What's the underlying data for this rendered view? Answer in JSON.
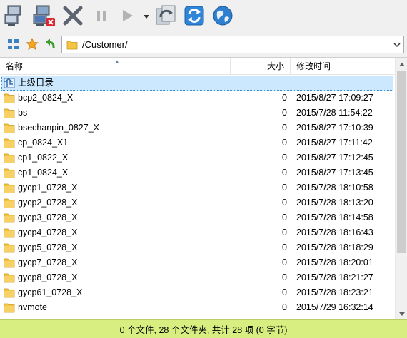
{
  "toolbar": {
    "buttons": [
      {
        "name": "connect",
        "icon": "network-computers-icon"
      },
      {
        "name": "disconnect",
        "icon": "disconnect-computers-icon"
      },
      {
        "name": "stop",
        "icon": "close-x-icon"
      },
      {
        "name": "pause",
        "icon": "pause-icon"
      },
      {
        "name": "play",
        "icon": "play-icon"
      },
      {
        "name": "sync",
        "icon": "sync-folder-icon"
      },
      {
        "name": "refresh",
        "icon": "refresh-icon"
      },
      {
        "name": "web",
        "icon": "globe-icon"
      }
    ]
  },
  "address_bar": {
    "path": "/Customer/"
  },
  "columns": {
    "name": "名称",
    "size": "大小",
    "modified": "修改时间"
  },
  "parent_row": {
    "label": "上级目录"
  },
  "files": [
    {
      "name": "bcp2_0824_X",
      "size": "0",
      "modified": "2015/8/27 17:09:27"
    },
    {
      "name": "bs",
      "size": "0",
      "modified": "2015/7/28 11:54:22"
    },
    {
      "name": "bsechanpin_0827_X",
      "size": "0",
      "modified": "2015/8/27 17:10:39"
    },
    {
      "name": "cp_0824_X1",
      "size": "0",
      "modified": "2015/8/27 17:11:42"
    },
    {
      "name": "cp1_0822_X",
      "size": "0",
      "modified": "2015/8/27 17:12:45"
    },
    {
      "name": "cp1_0824_X",
      "size": "0",
      "modified": "2015/8/27 17:13:45"
    },
    {
      "name": "gycp1_0728_X",
      "size": "0",
      "modified": "2015/7/28 18:10:58"
    },
    {
      "name": "gycp2_0728_X",
      "size": "0",
      "modified": "2015/7/28 18:13:20"
    },
    {
      "name": "gycp3_0728_X",
      "size": "0",
      "modified": "2015/7/28 18:14:58"
    },
    {
      "name": "gycp4_0728_X",
      "size": "0",
      "modified": "2015/7/28 18:16:43"
    },
    {
      "name": "gycp5_0728_X",
      "size": "0",
      "modified": "2015/7/28 18:18:29"
    },
    {
      "name": "gycp7_0728_X",
      "size": "0",
      "modified": "2015/7/28 18:20:01"
    },
    {
      "name": "gycp8_0728_X",
      "size": "0",
      "modified": "2015/7/28 18:21:27"
    },
    {
      "name": "gycp61_0728_X",
      "size": "0",
      "modified": "2015/7/28 18:23:21"
    },
    {
      "name": "nvmote",
      "size": "0",
      "modified": "2015/7/29 16:32:14"
    }
  ],
  "status": {
    "text": "0 个文件, 28 个文件夹, 共计 28 项 (0 字节)"
  },
  "colors": {
    "status_bg": "#d8ee80",
    "selection_bg": "#cce8ff",
    "folder_yellow": "#f4c542"
  }
}
